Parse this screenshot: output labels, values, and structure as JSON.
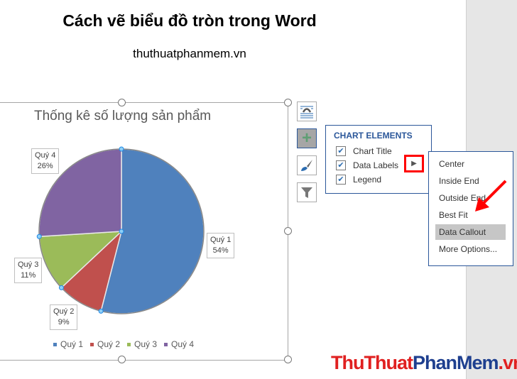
{
  "document": {
    "title": "Cách vẽ biểu đồ tròn trong Word",
    "subtitle": "thuthuatphanmem.vn"
  },
  "chart_data": {
    "type": "pie",
    "title": "Thống kê số lượng sản phẩm",
    "categories": [
      "Quý 1",
      "Quý 2",
      "Quý 3",
      "Quý 4"
    ],
    "values": [
      54,
      9,
      11,
      26
    ],
    "labels": [
      "54%",
      "9%",
      "11%",
      "26%"
    ],
    "colors": [
      "#4f81bd",
      "#c0504d",
      "#9bbb59",
      "#8064a2"
    ],
    "legend": "bottom"
  },
  "side_buttons": [
    {
      "icon": "layout-options-icon"
    },
    {
      "icon": "plus-icon"
    },
    {
      "icon": "brush-icon"
    },
    {
      "icon": "filter-icon"
    }
  ],
  "chart_elements": {
    "heading": "CHART ELEMENTS",
    "items": [
      {
        "label": "Chart Title",
        "checked": true
      },
      {
        "label": "Data Labels",
        "checked": true
      },
      {
        "label": "Legend",
        "checked": true
      }
    ]
  },
  "data_labels_menu": {
    "items": [
      "Center",
      "Inside End",
      "Outside End",
      "Best Fit",
      "Data Callout",
      "More Options..."
    ],
    "highlighted": "Data Callout"
  },
  "watermark": {
    "part1": "ThuThuat",
    "part2": "PhanMem",
    "part3": ".vn"
  }
}
